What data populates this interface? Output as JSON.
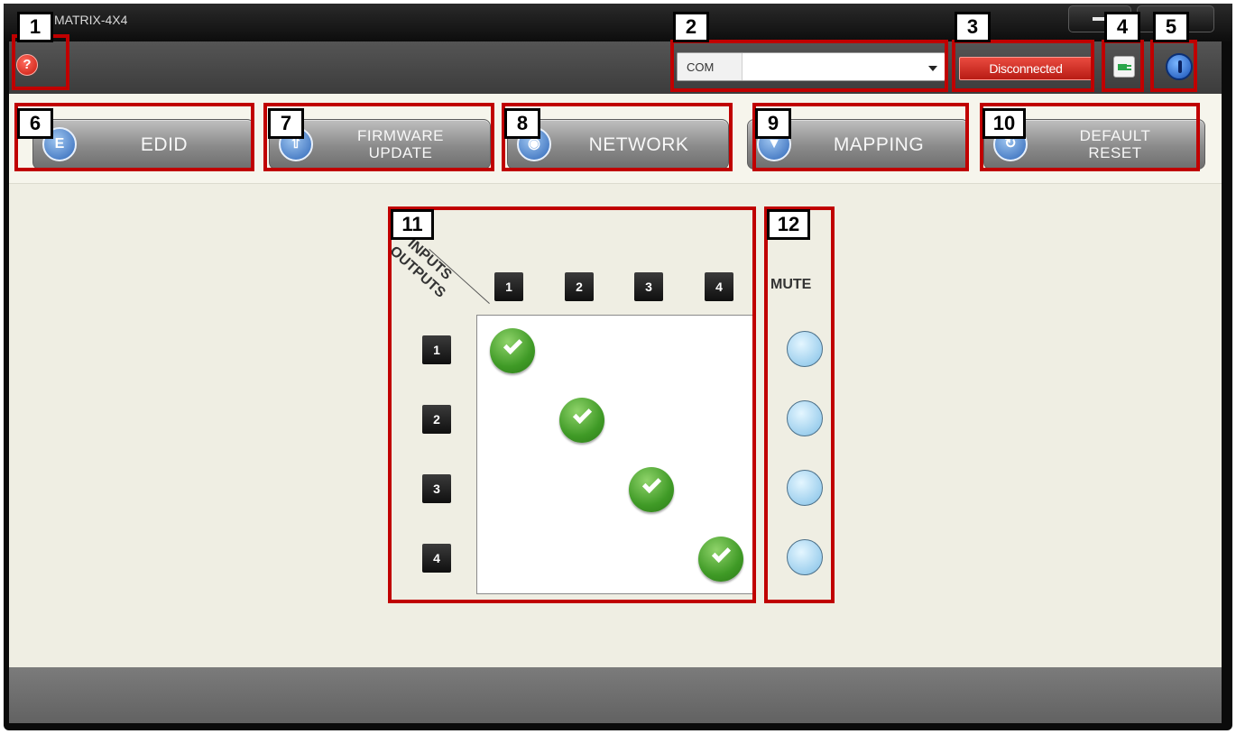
{
  "window": {
    "title": "MATRIX-4X4"
  },
  "toolbar": {
    "help_glyph": "?",
    "com_label": "COM",
    "com_value": "",
    "status_label": "Disconnected",
    "connect_icon": "plug-icon",
    "power_icon": "power-icon"
  },
  "functions": [
    {
      "label": "EDID",
      "icon": "edid-icon"
    },
    {
      "label": "FIRMWARE\nUPDATE",
      "line1": "FIRMWARE",
      "line2": "UPDATE",
      "icon": "firmware-icon"
    },
    {
      "label": "NETWORK",
      "icon": "wifi-icon"
    },
    {
      "label": "MAPPING",
      "icon": "location-pin-icon"
    },
    {
      "label": "DEFAULT\nRESET",
      "line1": "DEFAULT",
      "line2": "RESET",
      "icon": "reset-icon"
    }
  ],
  "matrix": {
    "corner_inputs": "INPUTS",
    "corner_outputs": "OUTPUTS",
    "inputs": [
      "1",
      "2",
      "3",
      "4"
    ],
    "outputs": [
      "1",
      "2",
      "3",
      "4"
    ],
    "routes": [
      1,
      2,
      3,
      4
    ],
    "mute_label": "MUTE",
    "mute_states": [
      false,
      false,
      false,
      false
    ]
  },
  "callouts": [
    "1",
    "2",
    "3",
    "4",
    "5",
    "6",
    "7",
    "8",
    "9",
    "10",
    "11",
    "12"
  ],
  "colors": {
    "callout_border": "#c00000",
    "status_red": "#d12a20",
    "check_green": "#3f9a26",
    "mute_blue": "#9fd0ee"
  }
}
